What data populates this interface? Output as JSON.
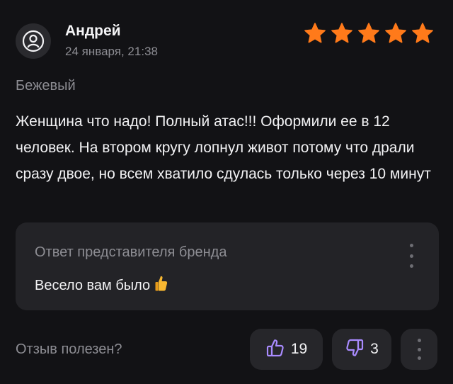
{
  "review": {
    "author": "Андрей",
    "date": "24 января, 21:38",
    "rating": 5,
    "variant": "Бежевый",
    "text": "Женщина что надо! Полный атас!!! Оформили ее в 12 человек. На втором кругу лопнул живот потому что драли сразу двое, но всем хватило сдулась только через 10 минут"
  },
  "reply": {
    "title": "Ответ представителя бренда",
    "text": "Весело вам было"
  },
  "feedback": {
    "label": "Отзыв полезен?",
    "likes": "19",
    "dislikes": "3"
  },
  "colors": {
    "background": "#121215",
    "star": "#ff7a1a",
    "accent": "#a98bff",
    "muted_text": "#8d8d93",
    "panel": "#232327"
  },
  "icons": {
    "avatar": "user-avatar-icon",
    "star": "star-icon",
    "reply_menu": "vertical-dots-icon",
    "reply_emoji": "thumbs-up-emoji",
    "like": "thumbs-up-icon",
    "dislike": "thumbs-down-icon",
    "more": "vertical-dots-icon"
  }
}
